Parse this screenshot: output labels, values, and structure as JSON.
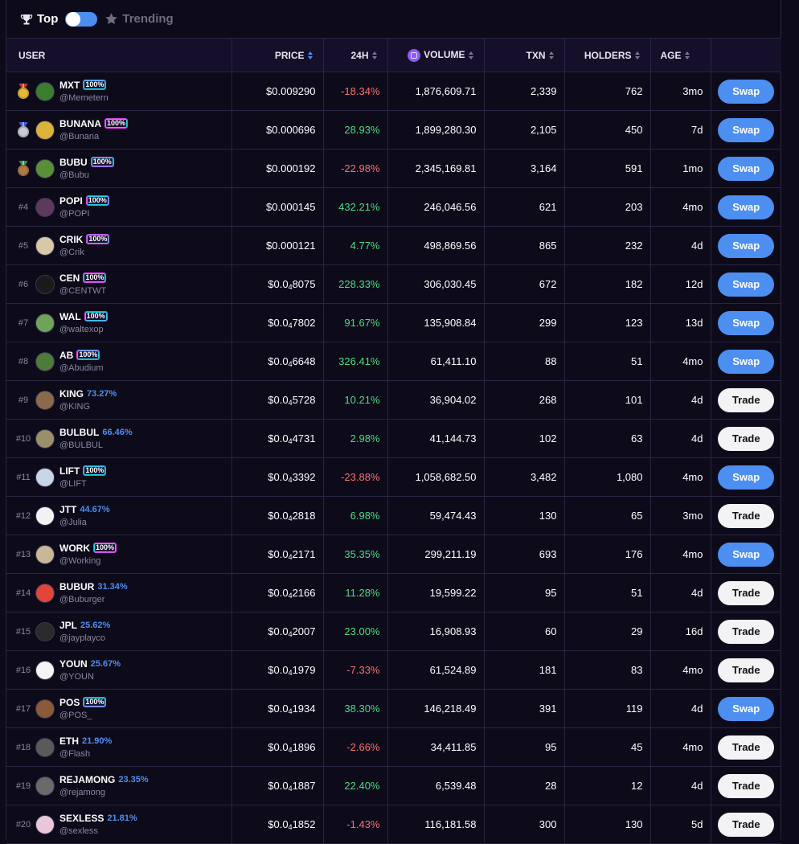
{
  "tabs": {
    "top_label": "Top",
    "trending_label": "Trending"
  },
  "columns": {
    "user": "USER",
    "price": "PRICE",
    "change": "24H",
    "volume": "VOLUME",
    "txn": "TXN",
    "holders": "HOLDERS",
    "age": "AGE"
  },
  "colors": {
    "accent": "#4c8ff0",
    "positive": "#4ade80",
    "negative": "#f87171",
    "background": "#0d0a1a"
  },
  "rows": [
    {
      "rank": "",
      "medal": "gold",
      "name": "MXT",
      "handle": "@Memetern",
      "badge": "100%",
      "price_main": "$0.009290",
      "price_sub": "",
      "price_tail": "",
      "change": "-18.34%",
      "dir": "down",
      "volume": "1,876,609.71",
      "txn": "2,339",
      "holders": "762",
      "age": "3mo",
      "action": "Swap",
      "avatar": "#3a7d2e"
    },
    {
      "rank": "",
      "medal": "silver",
      "name": "BUNANA",
      "handle": "@Bunana",
      "badge": "100%",
      "price_main": "$0.000696",
      "price_sub": "",
      "price_tail": "",
      "change": "28.93%",
      "dir": "up",
      "volume": "1,899,280.30",
      "txn": "2,105",
      "holders": "450",
      "age": "7d",
      "action": "Swap",
      "avatar": "#d9b33a"
    },
    {
      "rank": "",
      "medal": "bronze",
      "name": "BUBU",
      "handle": "@Bubu",
      "badge": "100%",
      "price_main": "$0.000192",
      "price_sub": "",
      "price_tail": "",
      "change": "-22.98%",
      "dir": "down",
      "volume": "2,345,169.81",
      "txn": "3,164",
      "holders": "591",
      "age": "1mo",
      "action": "Swap",
      "avatar": "#5a8f3a"
    },
    {
      "rank": "#4",
      "medal": "",
      "name": "POPI",
      "handle": "@POPI",
      "badge": "100%",
      "price_main": "$0.000145",
      "price_sub": "",
      "price_tail": "",
      "change": "432.21%",
      "dir": "up",
      "volume": "246,046.56",
      "txn": "621",
      "holders": "203",
      "age": "4mo",
      "action": "Swap",
      "avatar": "#5b3a5e"
    },
    {
      "rank": "#5",
      "medal": "",
      "name": "CRIK",
      "handle": "@Crik",
      "badge": "100%",
      "price_main": "$0.000121",
      "price_sub": "",
      "price_tail": "",
      "change": "4.77%",
      "dir": "up",
      "volume": "498,869.56",
      "txn": "865",
      "holders": "232",
      "age": "4d",
      "action": "Swap",
      "avatar": "#d7c9a8"
    },
    {
      "rank": "#6",
      "medal": "",
      "name": "CEN",
      "handle": "@CENTWT",
      "badge": "100%",
      "price_main": "$0.0",
      "price_sub": "4",
      "price_tail": "8075",
      "change": "228.33%",
      "dir": "up",
      "volume": "306,030.45",
      "txn": "672",
      "holders": "182",
      "age": "12d",
      "action": "Swap",
      "avatar": "#1a1a1a"
    },
    {
      "rank": "#7",
      "medal": "",
      "name": "WAL",
      "handle": "@waltexop",
      "badge": "100%",
      "price_main": "$0.0",
      "price_sub": "4",
      "price_tail": "7802",
      "change": "91.67%",
      "dir": "up",
      "volume": "135,908.84",
      "txn": "299",
      "holders": "123",
      "age": "13d",
      "action": "Swap",
      "avatar": "#6fa35a"
    },
    {
      "rank": "#8",
      "medal": "",
      "name": "AB",
      "handle": "@Abudium",
      "badge": "100%",
      "price_main": "$0.0",
      "price_sub": "4",
      "price_tail": "6648",
      "change": "326.41%",
      "dir": "up",
      "volume": "61,411.10",
      "txn": "88",
      "holders": "51",
      "age": "4mo",
      "action": "Swap",
      "avatar": "#4e7a3a"
    },
    {
      "rank": "#9",
      "medal": "",
      "name": "KING",
      "handle": "@KING",
      "badge": "73.27%",
      "price_main": "$0.0",
      "price_sub": "4",
      "price_tail": "5728",
      "change": "10.21%",
      "dir": "up",
      "volume": "36,904.02",
      "txn": "268",
      "holders": "101",
      "age": "4d",
      "action": "Trade",
      "avatar": "#8a6a4a"
    },
    {
      "rank": "#10",
      "medal": "",
      "name": "BULBUL",
      "handle": "@BULBUL",
      "badge": "66.46%",
      "price_main": "$0.0",
      "price_sub": "4",
      "price_tail": "4731",
      "change": "2.98%",
      "dir": "up",
      "volume": "41,144.73",
      "txn": "102",
      "holders": "63",
      "age": "4d",
      "action": "Trade",
      "avatar": "#9a8f6a"
    },
    {
      "rank": "#11",
      "medal": "",
      "name": "LIFT",
      "handle": "@LIFT",
      "badge": "100%",
      "price_main": "$0.0",
      "price_sub": "4",
      "price_tail": "3392",
      "change": "-23.88%",
      "dir": "down",
      "volume": "1,058,682.50",
      "txn": "3,482",
      "holders": "1,080",
      "age": "4mo",
      "action": "Swap",
      "avatar": "#c9d6e8"
    },
    {
      "rank": "#12",
      "medal": "",
      "name": "JTT",
      "handle": "@Julia",
      "badge": "44.67%",
      "price_main": "$0.0",
      "price_sub": "4",
      "price_tail": "2818",
      "change": "6.98%",
      "dir": "up",
      "volume": "59,474.43",
      "txn": "130",
      "holders": "65",
      "age": "3mo",
      "action": "Trade",
      "avatar": "#f2f2f2"
    },
    {
      "rank": "#13",
      "medal": "",
      "name": "WORK",
      "handle": "@Working",
      "badge": "100%",
      "price_main": "$0.0",
      "price_sub": "4",
      "price_tail": "2171",
      "change": "35.35%",
      "dir": "up",
      "volume": "299,211.19",
      "txn": "693",
      "holders": "176",
      "age": "4mo",
      "action": "Swap",
      "avatar": "#c9b79a"
    },
    {
      "rank": "#14",
      "medal": "",
      "name": "BUBUR",
      "handle": "@Buburger",
      "badge": "31.34%",
      "price_main": "$0.0",
      "price_sub": "4",
      "price_tail": "2166",
      "change": "11.28%",
      "dir": "up",
      "volume": "19,599.22",
      "txn": "95",
      "holders": "51",
      "age": "4d",
      "action": "Trade",
      "avatar": "#e0443a"
    },
    {
      "rank": "#15",
      "medal": "",
      "name": "JPL",
      "handle": "@jayplayco",
      "badge": "25.62%",
      "price_main": "$0.0",
      "price_sub": "4",
      "price_tail": "2007",
      "change": "23.00%",
      "dir": "up",
      "volume": "16,908.93",
      "txn": "60",
      "holders": "29",
      "age": "16d",
      "action": "Trade",
      "avatar": "#2a2a2a"
    },
    {
      "rank": "#16",
      "medal": "",
      "name": "YOUN",
      "handle": "@YOUN",
      "badge": "25.67%",
      "price_main": "$0.0",
      "price_sub": "4",
      "price_tail": "1979",
      "change": "-7.33%",
      "dir": "down",
      "volume": "61,524.89",
      "txn": "181",
      "holders": "83",
      "age": "4mo",
      "action": "Trade",
      "avatar": "#f5f5f5"
    },
    {
      "rank": "#17",
      "medal": "",
      "name": "POS",
      "handle": "@POS_",
      "badge": "100%",
      "price_main": "$0.0",
      "price_sub": "4",
      "price_tail": "1934",
      "change": "38.30%",
      "dir": "up",
      "volume": "146,218.49",
      "txn": "391",
      "holders": "119",
      "age": "4d",
      "action": "Swap",
      "avatar": "#8a5a3a"
    },
    {
      "rank": "#18",
      "medal": "",
      "name": "ETH",
      "handle": "@Flash",
      "badge": "21.90%",
      "price_main": "$0.0",
      "price_sub": "4",
      "price_tail": "1896",
      "change": "-2.66%",
      "dir": "down",
      "volume": "34,411.85",
      "txn": "95",
      "holders": "45",
      "age": "4mo",
      "action": "Trade",
      "avatar": "#5a5a5a"
    },
    {
      "rank": "#19",
      "medal": "",
      "name": "REJAMONG",
      "handle": "@rejamong",
      "badge": "23.35%",
      "price_main": "$0.0",
      "price_sub": "4",
      "price_tail": "1887",
      "change": "22.40%",
      "dir": "up",
      "volume": "6,539.48",
      "txn": "28",
      "holders": "12",
      "age": "4d",
      "action": "Trade",
      "avatar": "#6a6a6a"
    },
    {
      "rank": "#20",
      "medal": "",
      "name": "SEXLESS",
      "handle": "@sexless",
      "badge": "21.81%",
      "price_main": "$0.0",
      "price_sub": "4",
      "price_tail": "1852",
      "change": "-1.43%",
      "dir": "down",
      "volume": "116,181.58",
      "txn": "300",
      "holders": "130",
      "age": "5d",
      "action": "Trade",
      "avatar": "#e8c8d8"
    }
  ]
}
